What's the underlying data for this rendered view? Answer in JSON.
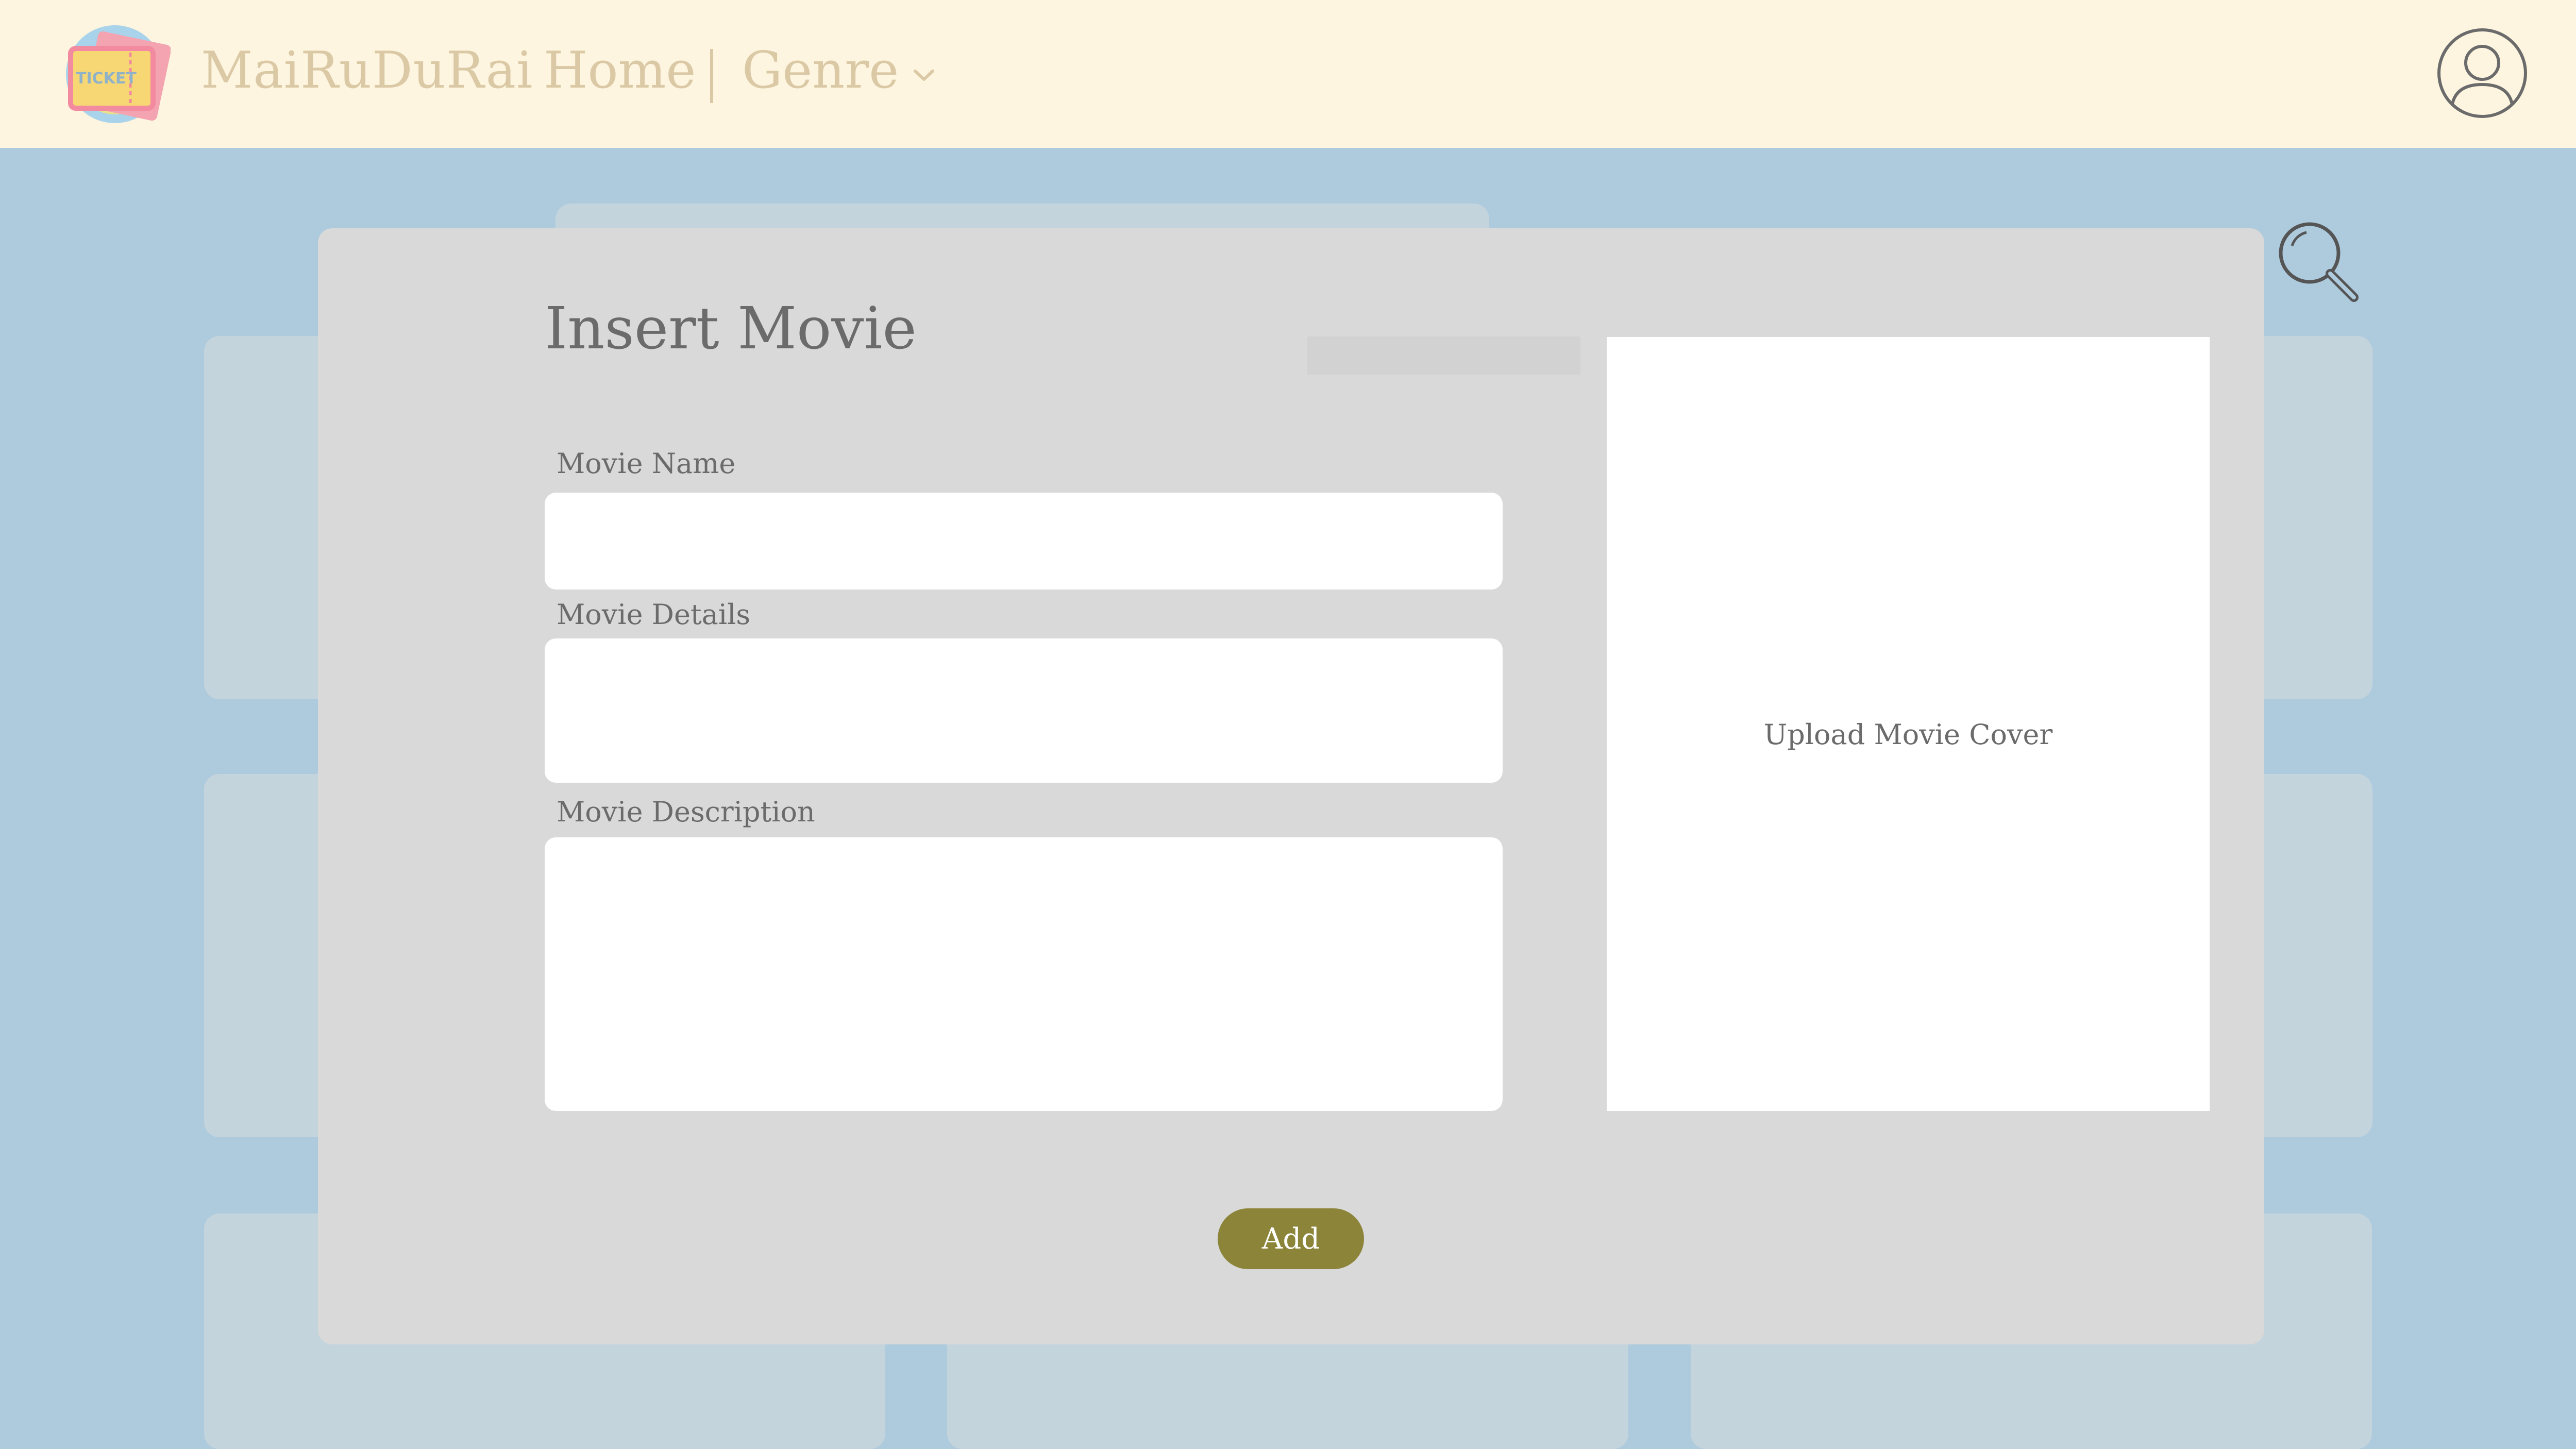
{
  "header": {
    "logo_text": "TICKET",
    "brand": "MaiRuDuRai",
    "nav": {
      "home": "Home",
      "genre": "Genre"
    }
  },
  "modal": {
    "title": "Insert Movie",
    "fields": {
      "name_label": "Movie Name",
      "name_value": "",
      "details_label": "Movie Details",
      "details_value": "",
      "description_label": "Movie Description",
      "description_value": ""
    },
    "upload_label": "Upload Movie Cover",
    "add_label": "Add"
  },
  "colors": {
    "header_bg": "#fdf5df",
    "page_bg": "#aecbde",
    "modal_bg": "#d9d9d9",
    "nav_text": "#dbc9a6",
    "add_button": "#8b8439"
  },
  "icons": {
    "logo": "ticket-logo-icon",
    "genre_dropdown": "chevron-down-icon",
    "profile": "user-avatar-icon",
    "search": "search-icon"
  }
}
